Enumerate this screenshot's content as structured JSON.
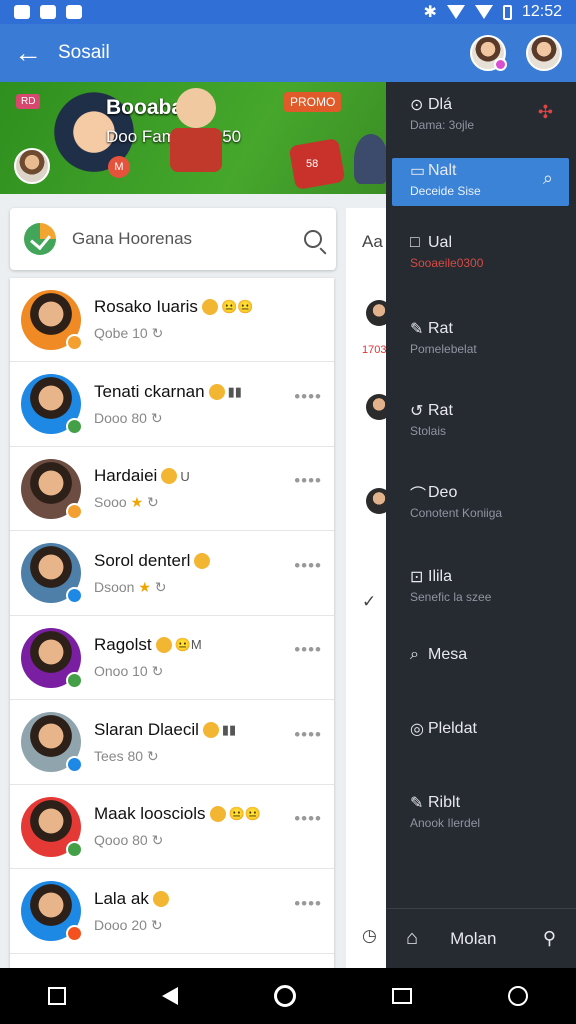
{
  "status_bar": {
    "time": "12:52"
  },
  "app_bar": {
    "title": "Sosail",
    "back_glyph": "←"
  },
  "banner": {
    "title": "Booaba",
    "subtitle": "Doo Famel : 2850",
    "tag": "RD",
    "promo": "PROMO",
    "badge": "M",
    "dice_label": "58"
  },
  "search": {
    "text": "Gana Hoorenas"
  },
  "contacts": [
    {
      "name": "Rosako Iuaris",
      "meta": "Qobe 10",
      "badge_color": "#f4a030",
      "avatar_bg": "#f08a24",
      "extra": "😐😐",
      "has_more": false
    },
    {
      "name": "Tenati ckarnan",
      "meta": "Dooo 80",
      "badge_color": "#43a047",
      "avatar_bg": "#1e88e5",
      "extra": "▮▮",
      "has_more": true
    },
    {
      "name": "Hardaiei",
      "meta": "Sooo",
      "badge_color": "#f4a030",
      "avatar_bg": "#6d4c41",
      "extra": "U",
      "has_more": true,
      "star": true
    },
    {
      "name": "Sorol denterl",
      "meta": "Dsoon",
      "badge_color": "#1e88e5",
      "avatar_bg": "#4e7fa8",
      "extra": "",
      "has_more": true,
      "star": true
    },
    {
      "name": "Ragolst",
      "meta": "Onoo 10",
      "badge_color": "#43a047",
      "avatar_bg": "#7b1fa2",
      "extra": "😐M",
      "has_more": true
    },
    {
      "name": "Slaran Dlaecil",
      "meta": "Tees 80",
      "badge_color": "#1e88e5",
      "avatar_bg": "#90a4ae",
      "extra": "▮▮",
      "has_more": true
    },
    {
      "name": "Maak loosciols",
      "meta": "Qooo 80",
      "badge_color": "#43a047",
      "avatar_bg": "#e53935",
      "extra": "😐😐",
      "has_more": true
    },
    {
      "name": "Lala ak",
      "meta": "Dooo 20",
      "badge_color": "#f4511e",
      "avatar_bg": "#1e88e5",
      "extra": "",
      "has_more": true
    }
  ],
  "mid_column": {
    "label": "Aa",
    "red_text": "1703"
  },
  "drawer": {
    "items": [
      {
        "glyph": "⊙",
        "title": "Dlá",
        "sub": "Dama: 3ojle",
        "right": "✣",
        "active": false
      },
      {
        "glyph": "▭",
        "title": "Nalt",
        "sub": "Deceide Sise",
        "right": "⌕",
        "active": true
      },
      {
        "glyph": "□",
        "title": "Ual",
        "sub": "Sooaeile0300",
        "right": "",
        "active": false
      },
      {
        "glyph": "✎",
        "title": "Rat",
        "sub": "Pomelebelat",
        "right": "",
        "active": false
      },
      {
        "glyph": "↺",
        "title": "Rat",
        "sub": "Stolais",
        "right": "",
        "active": false
      },
      {
        "glyph": "⌒",
        "title": "Deo",
        "sub": "Conotent Koniiga",
        "right": "",
        "active": false
      },
      {
        "glyph": "⊡",
        "title": "Ilila",
        "sub": "Senefic la szee",
        "right": "",
        "active": false
      },
      {
        "glyph": "⌕",
        "title": "Mesa",
        "sub": "",
        "right": "",
        "active": false
      },
      {
        "glyph": "◎",
        "title": "Pleldat",
        "sub": "",
        "right": "",
        "active": false
      },
      {
        "glyph": "✎",
        "title": "Riblt",
        "sub": "Anook Ilerdel",
        "right": "",
        "active": false
      }
    ],
    "footer_label": "Molan"
  }
}
